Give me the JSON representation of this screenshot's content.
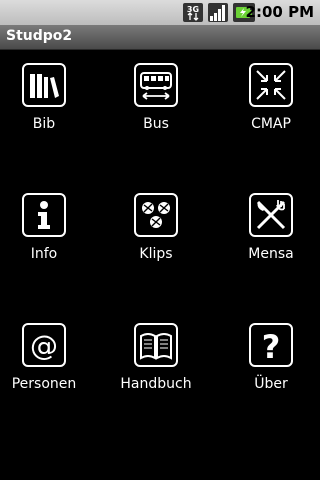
{
  "status_bar": {
    "network": "3G",
    "time": "2:00 PM"
  },
  "app": {
    "title": "Studpo2"
  },
  "tiles": [
    {
      "label": "Bib",
      "icon": "books-icon"
    },
    {
      "label": "Bus",
      "icon": "bus-icon"
    },
    {
      "label": "CMAP",
      "icon": "compress-arrows-icon"
    },
    {
      "label": "Info",
      "icon": "info-icon"
    },
    {
      "label": "Klips",
      "icon": "pinwheels-icon"
    },
    {
      "label": "Mensa",
      "icon": "fork-knife-icon"
    },
    {
      "label": "Personen",
      "icon": "at-sign-icon"
    },
    {
      "label": "Handbuch",
      "icon": "open-book-icon"
    },
    {
      "label": "Über",
      "icon": "question-mark-icon"
    }
  ]
}
